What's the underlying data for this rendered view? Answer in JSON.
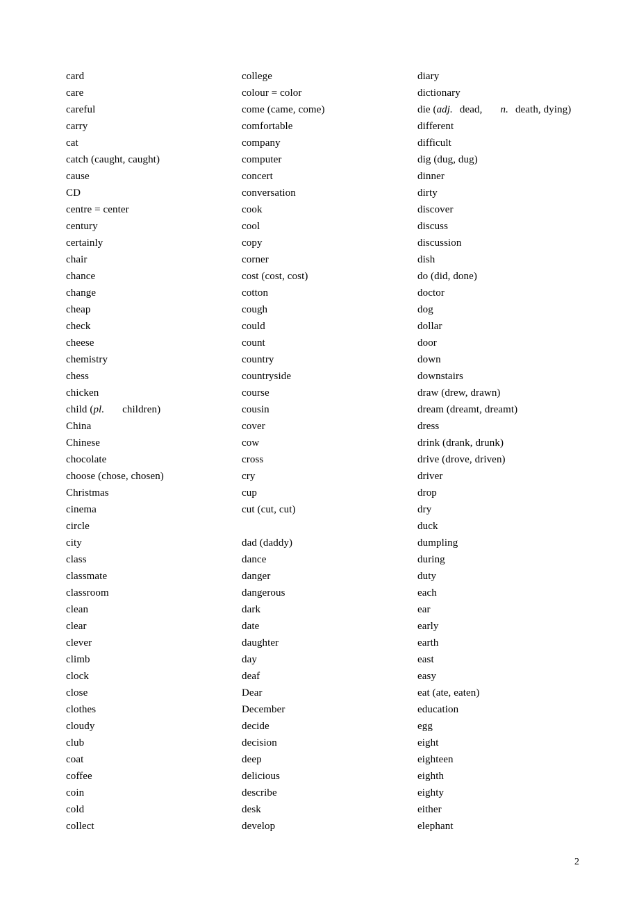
{
  "document": {
    "page_number": "2",
    "columns": [
      {
        "name": "column-1",
        "entries": [
          {
            "text": "card"
          },
          {
            "text": "care"
          },
          {
            "text": "careful"
          },
          {
            "text": "carry"
          },
          {
            "text": "cat"
          },
          {
            "text": "catch (caught, caught)"
          },
          {
            "text": "cause"
          },
          {
            "text": "CD"
          },
          {
            "text": "centre = center"
          },
          {
            "text": "century"
          },
          {
            "text": "certainly"
          },
          {
            "text": "chair"
          },
          {
            "text": "chance"
          },
          {
            "text": "change"
          },
          {
            "text": "cheap"
          },
          {
            "text": "check"
          },
          {
            "text": "cheese"
          },
          {
            "text": "chemistry"
          },
          {
            "text": "chess"
          },
          {
            "text": "chicken"
          },
          {
            "text": "child (pl.  children)",
            "parts": [
              {
                "t": "child (",
                "style": "normal"
              },
              {
                "t": "pl.",
                "style": "italic"
              },
              {
                "t": "children)",
                "style": "normal",
                "lead": "large"
              }
            ]
          },
          {
            "text": "China"
          },
          {
            "text": "Chinese"
          },
          {
            "text": "chocolate"
          },
          {
            "text": "choose (chose, chosen)"
          },
          {
            "text": "Christmas"
          },
          {
            "text": "cinema"
          },
          {
            "text": "circle"
          },
          {
            "text": "city"
          },
          {
            "text": "class"
          },
          {
            "text": "classmate"
          },
          {
            "text": "classroom"
          },
          {
            "text": "clean"
          },
          {
            "text": "clear"
          },
          {
            "text": "clever"
          },
          {
            "text": "climb"
          },
          {
            "text": "clock"
          },
          {
            "text": "close"
          },
          {
            "text": "clothes"
          },
          {
            "text": "cloudy"
          },
          {
            "text": "club"
          },
          {
            "text": "coat"
          },
          {
            "text": "coffee"
          },
          {
            "text": "coin"
          },
          {
            "text": "cold"
          },
          {
            "text": "collect"
          }
        ]
      },
      {
        "name": "column-2",
        "entries": [
          {
            "text": "college"
          },
          {
            "text": "colour = color"
          },
          {
            "text": "come (came, come)"
          },
          {
            "text": "comfortable"
          },
          {
            "text": "company"
          },
          {
            "text": "computer"
          },
          {
            "text": "concert"
          },
          {
            "text": "conversation"
          },
          {
            "text": "cook"
          },
          {
            "text": "cool"
          },
          {
            "text": "copy"
          },
          {
            "text": "corner"
          },
          {
            "text": "cost (cost, cost)"
          },
          {
            "text": "cotton"
          },
          {
            "text": "cough"
          },
          {
            "text": "could"
          },
          {
            "text": "count"
          },
          {
            "text": "country"
          },
          {
            "text": "countryside"
          },
          {
            "text": "course"
          },
          {
            "text": "cousin"
          },
          {
            "text": "cover"
          },
          {
            "text": "cow"
          },
          {
            "text": "cross"
          },
          {
            "text": "cry"
          },
          {
            "text": "cup"
          },
          {
            "text": "cut (cut, cut)"
          },
          {
            "text": "",
            "blank": true
          },
          {
            "text": "dad (daddy)"
          },
          {
            "text": "dance"
          },
          {
            "text": "danger"
          },
          {
            "text": "dangerous"
          },
          {
            "text": "dark"
          },
          {
            "text": "date"
          },
          {
            "text": "daughter"
          },
          {
            "text": "day"
          },
          {
            "text": "deaf"
          },
          {
            "text": "Dear"
          },
          {
            "text": "December"
          },
          {
            "text": "decide"
          },
          {
            "text": "decision"
          },
          {
            "text": "deep"
          },
          {
            "text": "delicious"
          },
          {
            "text": "describe"
          },
          {
            "text": "desk"
          },
          {
            "text": "develop"
          }
        ]
      },
      {
        "name": "column-3",
        "entries": [
          {
            "text": "diary"
          },
          {
            "text": "dictionary"
          },
          {
            "text": "die (adj. dead,    n. death, dying)",
            "parts": [
              {
                "t": "die (",
                "style": "normal"
              },
              {
                "t": "adj.",
                "style": "italic"
              },
              {
                "t": "dead,",
                "style": "normal",
                "lead": "small"
              },
              {
                "t": "n.",
                "style": "italic",
                "lead": "large"
              },
              {
                "t": "death, dying)",
                "style": "normal",
                "lead": "small"
              }
            ]
          },
          {
            "text": "different"
          },
          {
            "text": "difficult"
          },
          {
            "text": "dig (dug, dug)"
          },
          {
            "text": "dinner"
          },
          {
            "text": "dirty"
          },
          {
            "text": "discover"
          },
          {
            "text": "discuss"
          },
          {
            "text": "discussion"
          },
          {
            "text": "dish"
          },
          {
            "text": "do (did, done)"
          },
          {
            "text": "doctor"
          },
          {
            "text": "dog"
          },
          {
            "text": "dollar"
          },
          {
            "text": "door"
          },
          {
            "text": "down"
          },
          {
            "text": "downstairs"
          },
          {
            "text": "draw (drew, drawn)"
          },
          {
            "text": "dream (dreamt, dreamt)"
          },
          {
            "text": "dress"
          },
          {
            "text": "drink (drank, drunk)"
          },
          {
            "text": "drive (drove, driven)"
          },
          {
            "text": "driver"
          },
          {
            "text": "drop"
          },
          {
            "text": "dry"
          },
          {
            "text": "duck"
          },
          {
            "text": "dumpling"
          },
          {
            "text": "during"
          },
          {
            "text": "duty"
          },
          {
            "text": "each"
          },
          {
            "text": "ear"
          },
          {
            "text": "early"
          },
          {
            "text": "earth"
          },
          {
            "text": "east"
          },
          {
            "text": "easy"
          },
          {
            "text": "eat (ate, eaten)"
          },
          {
            "text": "education"
          },
          {
            "text": "egg"
          },
          {
            "text": "eight"
          },
          {
            "text": "eighteen"
          },
          {
            "text": "eighth"
          },
          {
            "text": "eighty"
          },
          {
            "text": "either"
          },
          {
            "text": "elephant"
          }
        ]
      }
    ]
  }
}
